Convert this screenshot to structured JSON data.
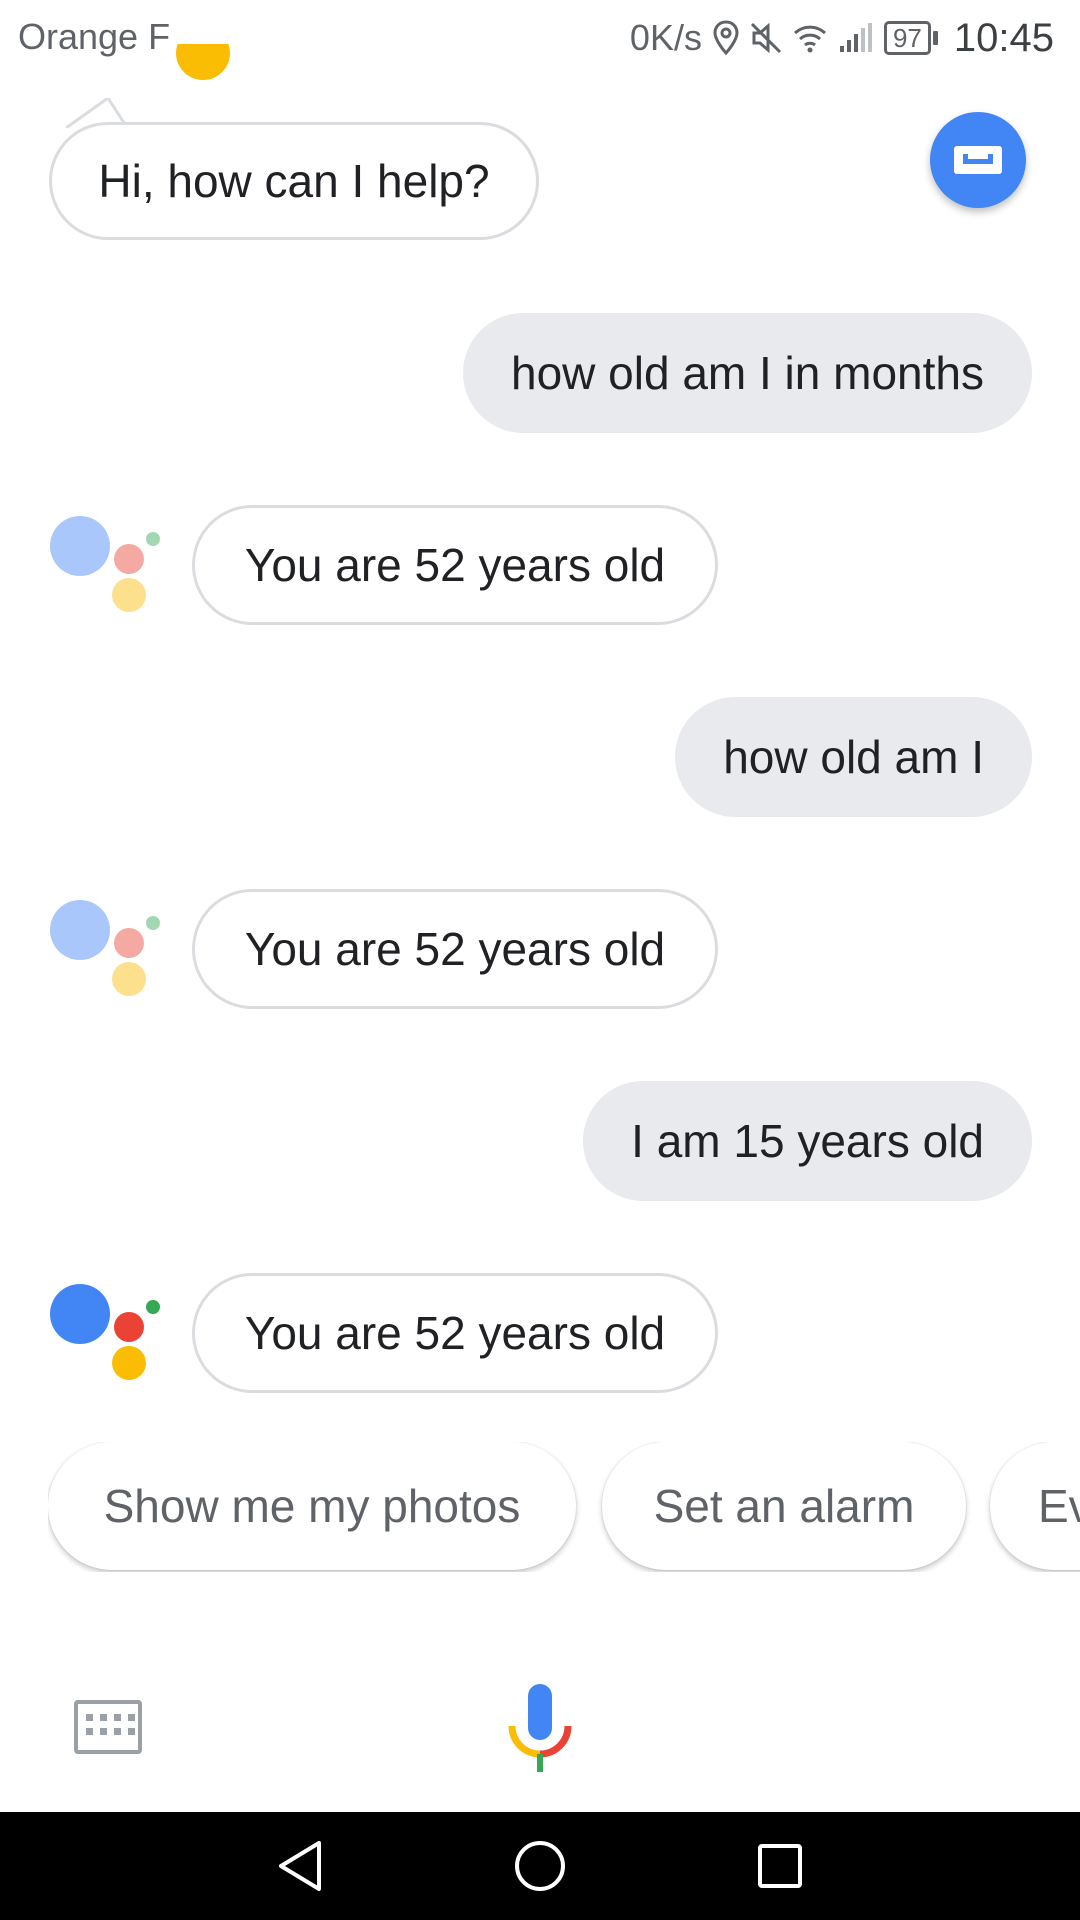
{
  "status_bar": {
    "carrier": "Orange F",
    "net_speed": "0K/s",
    "battery": "97",
    "time": "10:45"
  },
  "conversation": {
    "greeting": "Hi, how can I help?",
    "messages": [
      {
        "from": "user",
        "text": "how old am I in months"
      },
      {
        "from": "assistant",
        "text": "You are 52 years old"
      },
      {
        "from": "user",
        "text": "how old am I"
      },
      {
        "from": "assistant",
        "text": "You are 52 years old"
      },
      {
        "from": "user",
        "text": "I am 15 years old"
      },
      {
        "from": "assistant",
        "text": "You are 52 years old"
      }
    ]
  },
  "suggestions": [
    "Show me my photos",
    "Set an alarm",
    "Ev"
  ],
  "icons": {
    "keyboard_fab": "keyboard-icon",
    "keyboard_button": "keyboard-icon",
    "mic_button": "microphone-icon",
    "nav": [
      "back-icon",
      "home-icon",
      "recents-icon"
    ]
  },
  "colors": {
    "blue": "#4285f4",
    "red": "#ea4335",
    "yellow": "#fbbc04",
    "green": "#34a853",
    "user_bubble": "#e8eaed"
  }
}
